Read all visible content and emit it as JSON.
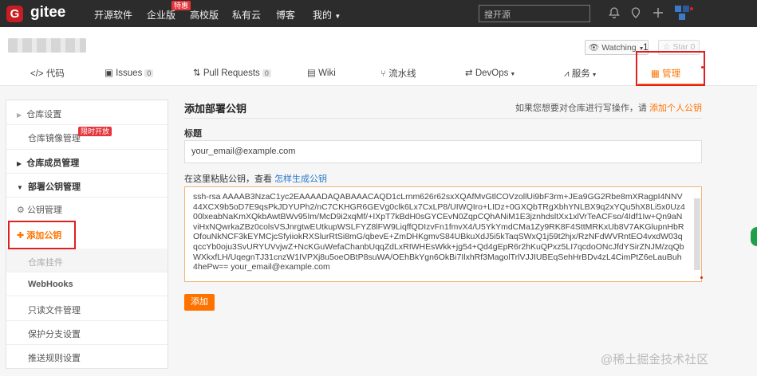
{
  "topbar": {
    "logo_letter": "G",
    "brand": "gitee",
    "nav": [
      "开源软件",
      "企业版",
      "高校版",
      "私有云",
      "博客",
      "我的"
    ],
    "hot_badge": "特惠",
    "search_placeholder": "搜开源"
  },
  "repo": {
    "watch_label": "Watching",
    "watch_count": "1",
    "star_label": "Star",
    "star_count": "0"
  },
  "tabs": [
    {
      "label": "代码"
    },
    {
      "label": "Issues",
      "count": "0"
    },
    {
      "label": "Pull Requests",
      "count": "0"
    },
    {
      "label": "Wiki"
    },
    {
      "label": "流水线"
    },
    {
      "label": "DevOps"
    },
    {
      "label": "服务"
    },
    {
      "label": "管理"
    }
  ],
  "sidebar": {
    "items": [
      {
        "label": "仓库设置"
      },
      {
        "label": "仓库镜像管理",
        "badge": "限时开放"
      },
      {
        "label": "仓库成员管理"
      },
      {
        "label": "部署公钥管理"
      },
      {
        "label": "公钥管理"
      },
      {
        "label": "添加公钥"
      },
      {
        "label": "仓库挂件"
      },
      {
        "label": "WebHooks"
      },
      {
        "label": "只读文件管理"
      },
      {
        "label": "保护分支设置"
      },
      {
        "label": "推送规则设置"
      }
    ]
  },
  "main": {
    "title": "添加部署公钥",
    "hint_prefix": "如果您想要对仓库进行写操作，请",
    "hint_link": "添加个人公钥",
    "title_label": "标题",
    "title_value": "your_email@example.com",
    "key_label_prefix": "在这里粘贴公钥，查看",
    "key_label_link": "怎样生成公钥",
    "key_value": "ssh-rsa AAAAB3NzaC1yc2EAAAADAQABAAACAQD1cLrnm626r62sxXQAfMvGtlCOVzollUi9bF3rm+JEa9GG2Rbe8mXRagpI4NNV44XCX9b5oD7E9qsPkJDYUPh2/nC7CKHGR6GEVg0clk6Lx7CxLP8/UIWQIro+LIDz+0GXQbTRgXbhYNLBX9q2xYQu5hX8Li5x0Uz400lxeabNaKmXQkbAwtBWv95Im/McD9i2xqMf/+IXpT7kBdH0sGYCEvN0ZqpCQhANiM1E3jznhdsltXx1xlVrTeACFso/4Idf1Iw+Qn9aNviHxNQwrkaZBz0colsVSJnrgtwEUtkupWSLFYZ8lFW9LiqffQDIzvFn1fmvX4/U5YkYmdCMa1Zy9RK8F4SttMRKxUb8V7AKGlupnHbROfouNkNCF3kEYMCjcSfyiiokRXSlurRtSi8mG/qbevE+ZmDHKgmvS84UBkuXdJ5i5kTaqSWxQ1j59t2hjx/RzNFdWVRntEO4vxdW03qqccYb0oju3SvURYUVvjwZ+NcKGuWefaChanbUqqZdLxRIWHEsWkk+jg54+Qd4gEpR6r2hKuQPxz5LI7qcdoONcJfdYSirZNJM/zqQbWXkxfLH/UqegnTJ31cnzW1IVPXj8u5oeOBtP8suWA/OEhBkYgn6OkBi7IlxhRf3MagolTrlVJJIUBEqSehHrBDv4zL4CimPtZ6eLauBuh4hePw== your_email@example.com",
    "submit_label": "添加"
  },
  "watermark": "@稀土掘金技术社区"
}
